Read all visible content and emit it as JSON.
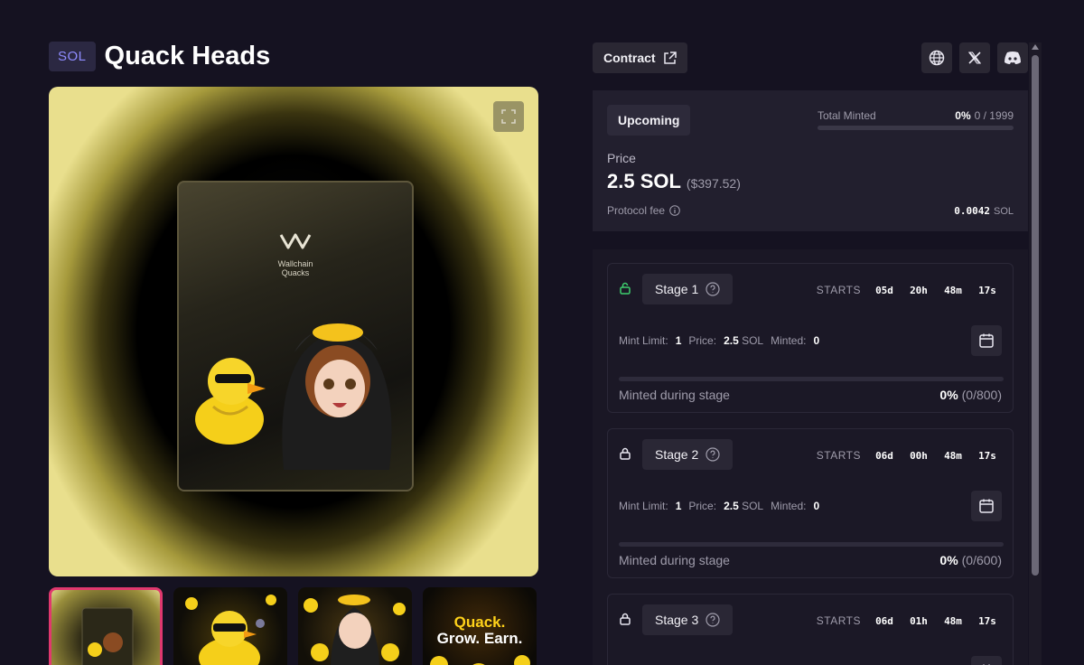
{
  "collection": {
    "chain": "SOL",
    "title": "Quack Heads",
    "pack_brand": "Wallchain Quacks"
  },
  "header": {
    "contract_label": "Contract",
    "socials": [
      "globe-icon",
      "x-icon",
      "discord-icon"
    ]
  },
  "mint": {
    "status": "Upcoming",
    "total_minted_label": "Total Minted",
    "total_minted_percent": "0%",
    "total_minted_count": "0 / 1999",
    "total_minted_fraction": 0,
    "price_label": "Price",
    "price": "2.5 SOL",
    "price_usd": "($397.52)",
    "fee_label": "Protocol fee",
    "fee_value": "0.0042",
    "fee_unit": "SOL"
  },
  "stages": [
    {
      "name": "Stage 1",
      "unlocked": true,
      "starts_label": "STARTS",
      "countdown": [
        "05d",
        "20h",
        "48m",
        "17s"
      ],
      "mint_limit_label": "Mint Limit:",
      "mint_limit": "1",
      "price_label": "Price:",
      "price_value": "2.5",
      "price_unit": "SOL",
      "minted_label": "Minted:",
      "minted": "0",
      "progress_label": "Minted during stage",
      "progress_percent": "0%",
      "progress_count": "(0/800)",
      "progress_fraction": 0
    },
    {
      "name": "Stage 2",
      "unlocked": false,
      "starts_label": "STARTS",
      "countdown": [
        "06d",
        "00h",
        "48m",
        "17s"
      ],
      "mint_limit_label": "Mint Limit:",
      "mint_limit": "1",
      "price_label": "Price:",
      "price_value": "2.5",
      "price_unit": "SOL",
      "minted_label": "Minted:",
      "minted": "0",
      "progress_label": "Minted during stage",
      "progress_percent": "0%",
      "progress_count": "(0/600)",
      "progress_fraction": 0
    },
    {
      "name": "Stage 3",
      "unlocked": false,
      "starts_label": "STARTS",
      "countdown": [
        "06d",
        "01h",
        "48m",
        "17s"
      ]
    }
  ],
  "thumbnails": {
    "t4_line1": "Quack.",
    "t4_line2": "Grow. Earn."
  },
  "colors": {
    "background": "#151221",
    "accent_pink": "#e0386e",
    "unlock_green": "#3ecf6e",
    "chain_badge_text": "#8f8cff"
  }
}
